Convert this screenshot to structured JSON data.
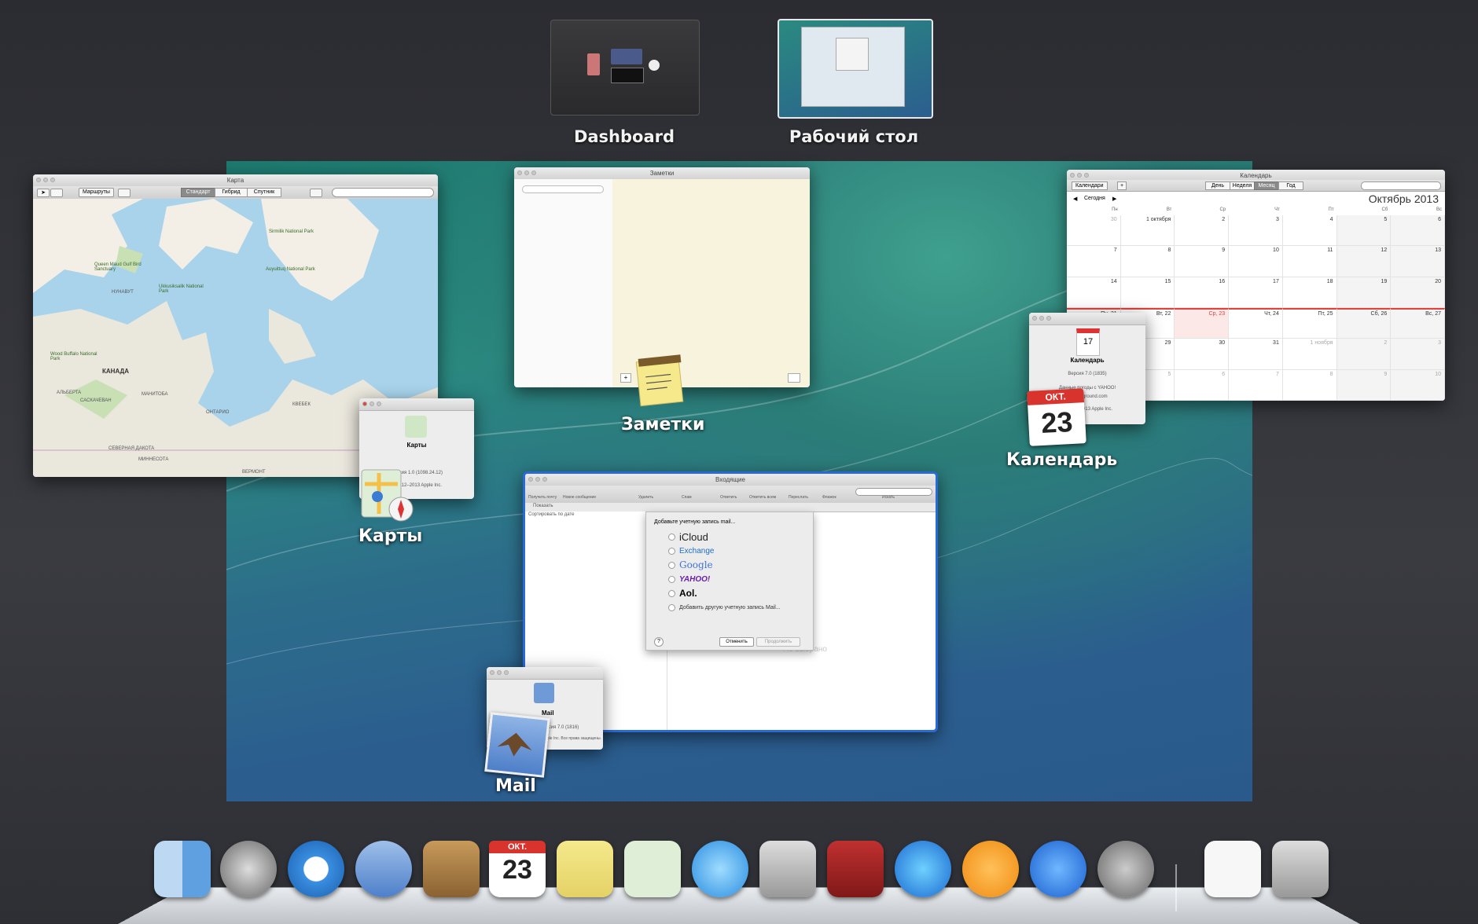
{
  "spaces": {
    "dashboard_label": "Dashboard",
    "desktop_label": "Рабочий стол"
  },
  "maps": {
    "window_title": "Карта",
    "routes_btn": "Маршруты",
    "seg_standard": "Стандарт",
    "seg_hybrid": "Гибрид",
    "seg_satellite": "Спутник",
    "labels": [
      "Queen Maud Gulf Bird Sanctuary",
      "Sirmilik National Park",
      "Ukkusiksalik National Park",
      "Auyuittuq National Park",
      "НУНАВУТ",
      "КАНАДА",
      "Wood Buffalo National Park",
      "АЛЬБЕРТА",
      "САСКАЧЕВАН",
      "МАНИТОБА",
      "ОНТАРИО",
      "КВЕБЕК",
      "СЕВЕРНАЯ ДАКОТА",
      "МИННЕСОТА",
      "ВЕРМОНТ"
    ],
    "about_name": "Карты",
    "about_version": "Версия 1.0 (1098.24.12)",
    "about_copy": "© 2012–2013 Apple Inc.",
    "app_label": "Карты"
  },
  "notes": {
    "window_title": "Заметки",
    "app_label": "Заметки"
  },
  "calendar": {
    "window_title": "Календарь",
    "btn_calendars": "Календари",
    "views": [
      "День",
      "Неделя",
      "Месяц",
      "Год"
    ],
    "today": "Сегодня",
    "month_title": "Октябрь 2013",
    "weekdays": [
      "Пн",
      "Вт",
      "Ср",
      "Чт",
      "Пт",
      "Сб",
      "Вс"
    ],
    "weeks": [
      [
        "30",
        "1 октября",
        "2",
        "3",
        "4",
        "5",
        "6"
      ],
      [
        "7",
        "8",
        "9",
        "10",
        "11",
        "12",
        "13"
      ],
      [
        "14",
        "15",
        "16",
        "17",
        "18",
        "19",
        "20"
      ],
      [
        "Пн, 21",
        "Вт, 22",
        "Ср, 23",
        "Чт, 24",
        "Пт, 25",
        "Сб, 26",
        "Вс, 27"
      ],
      [
        "28",
        "29",
        "30",
        "31",
        "1 ноября",
        "2",
        "3"
      ],
      [
        "4",
        "5",
        "6",
        "7",
        "8",
        "9",
        "10"
      ]
    ],
    "about_name": "Календарь",
    "about_version": "Версия 7.0 (1835)",
    "about_weather": "Данные погоды с YAHOO!",
    "about_wunder": "wunderground.com",
    "about_copy": "© 2002–2013 Apple Inc.",
    "icon_month": "ОКТ.",
    "icon_day": "23",
    "app_label": "Календарь"
  },
  "mail": {
    "window_title": "Входящие",
    "toolbar": [
      "Получить почту",
      "Новое сообщение",
      "Удалить",
      "Спам",
      "Ответить",
      "Ответить всем",
      "Переслать",
      "Флажок",
      "Искать"
    ],
    "show_label": "Показать",
    "sort_label": "Сортировать по дате",
    "no_selection": "Не выбрано",
    "sheet_title": "Добавьте учетную запись mail...",
    "providers": [
      "iCloud",
      "Exchange",
      "Google",
      "YAHOO!",
      "Aol.",
      "Добавить другую учетную запись Mail..."
    ],
    "cancel_btn": "Отменить",
    "continue_btn": "Продолжить",
    "help": "?",
    "about_name": "Mail",
    "about_version": "Версия 7.0 (1816)",
    "about_copy": "© Apple Inc. Все права защищены.",
    "app_label": "Mail"
  },
  "dock": {
    "items": [
      "Finder",
      "Launchpad",
      "Safari",
      "Mail",
      "Контакты",
      "Календарь",
      "Заметки",
      "Карты",
      "Сообщения",
      "FaceTime",
      "Photo Booth",
      "iTunes",
      "iBooks",
      "App Store",
      "Системные настройки",
      "Документ",
      "Корзина"
    ]
  },
  "colors": {
    "accent_blue": "#2a6ad8",
    "today_red": "#e3413b",
    "bg_dark": "#323338"
  }
}
